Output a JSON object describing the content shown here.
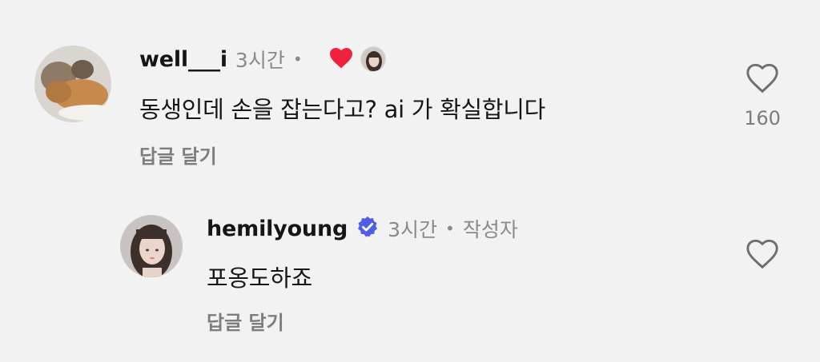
{
  "comments": [
    {
      "username": "well___i",
      "time": "3시간",
      "separator": "•",
      "text": "동생인데 손을 잡는다고? ai 가 확실합니다",
      "reply_label": "답글 달기",
      "like_count": "160",
      "creator_liked": true
    },
    {
      "username": "hemilyoung",
      "verified": true,
      "time": "3시간",
      "separator": "•",
      "role": "작성자",
      "text": "포옹도하죠",
      "reply_label": "답글 달기"
    }
  ],
  "colors": {
    "background": "#f2f2f2",
    "liked_heart": "#f0213b",
    "verified_badge": "#4f5ee8",
    "secondary_text": "#8a8a8a"
  },
  "icons": [
    "heart-outline-icon",
    "heart-filled-icon",
    "verified-badge-icon"
  ]
}
